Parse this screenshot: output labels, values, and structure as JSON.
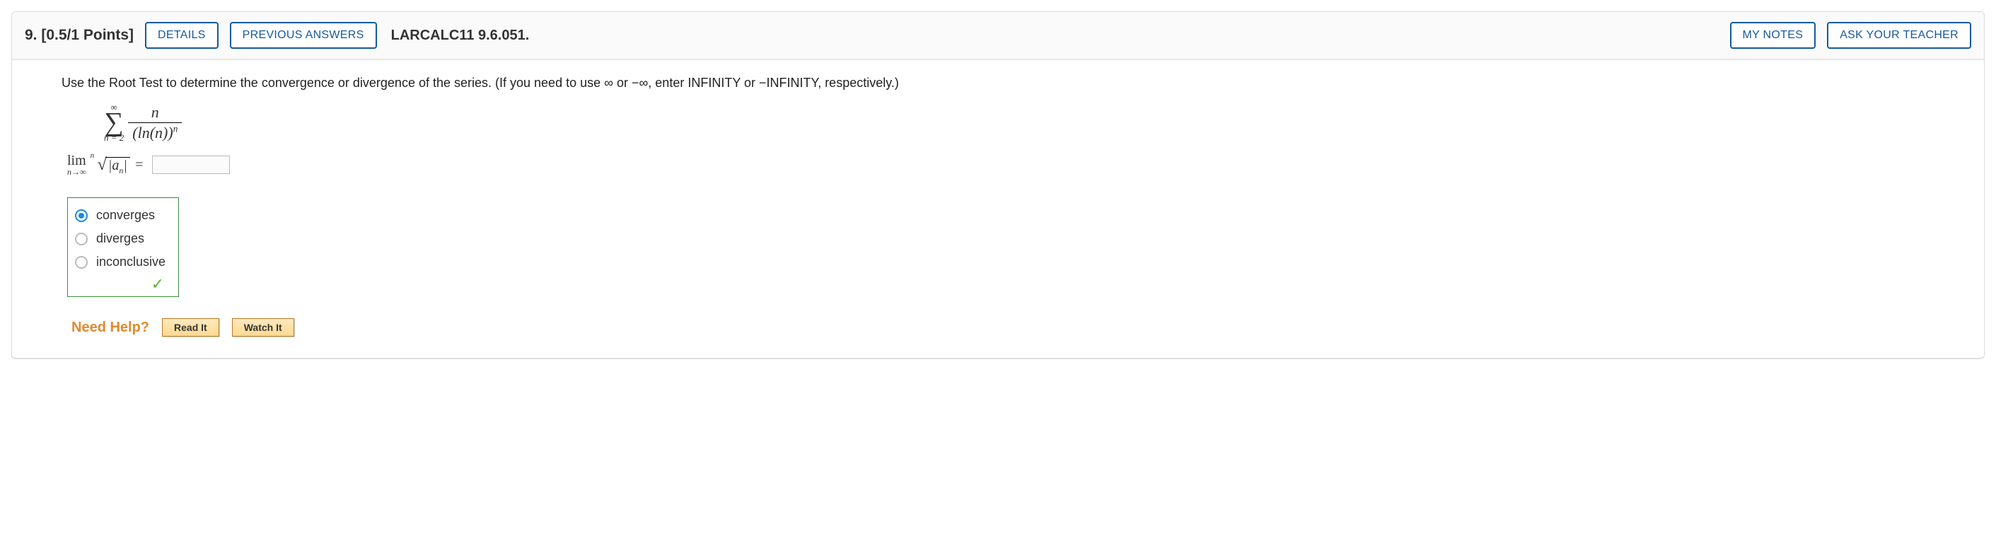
{
  "header": {
    "number_points": "9.  [0.5/1 Points]",
    "details_btn": "DETAILS",
    "previous_answers_btn": "PREVIOUS ANSWERS",
    "source_label": "LARCALC11 9.6.051.",
    "my_notes_btn": "MY NOTES",
    "ask_teacher_btn": "ASK YOUR TEACHER"
  },
  "prompt": "Use the Root Test to determine the convergence or divergence of the series. (If you need to use ∞ or −∞, enter INFINITY or −INFINITY, respectively.)",
  "series": {
    "sigma_top": "∞",
    "sigma_bottom": "n = 2",
    "numerator": "n",
    "denominator_base": "(ln(n))",
    "denominator_exp": "n"
  },
  "limit_expr": {
    "lim_word": "lim",
    "lim_sub": "n→∞",
    "root_index": "n",
    "radicand_left": "|a",
    "radicand_sub": "n",
    "radicand_right": "|",
    "equals": "="
  },
  "answer_input": {
    "value": ""
  },
  "choices": {
    "options": [
      {
        "label": "converges",
        "selected": true
      },
      {
        "label": "diverges",
        "selected": false
      },
      {
        "label": "inconclusive",
        "selected": false
      }
    ],
    "correct_mark": "✓"
  },
  "help": {
    "label": "Need Help?",
    "read_btn": "Read It",
    "watch_btn": "Watch It"
  }
}
